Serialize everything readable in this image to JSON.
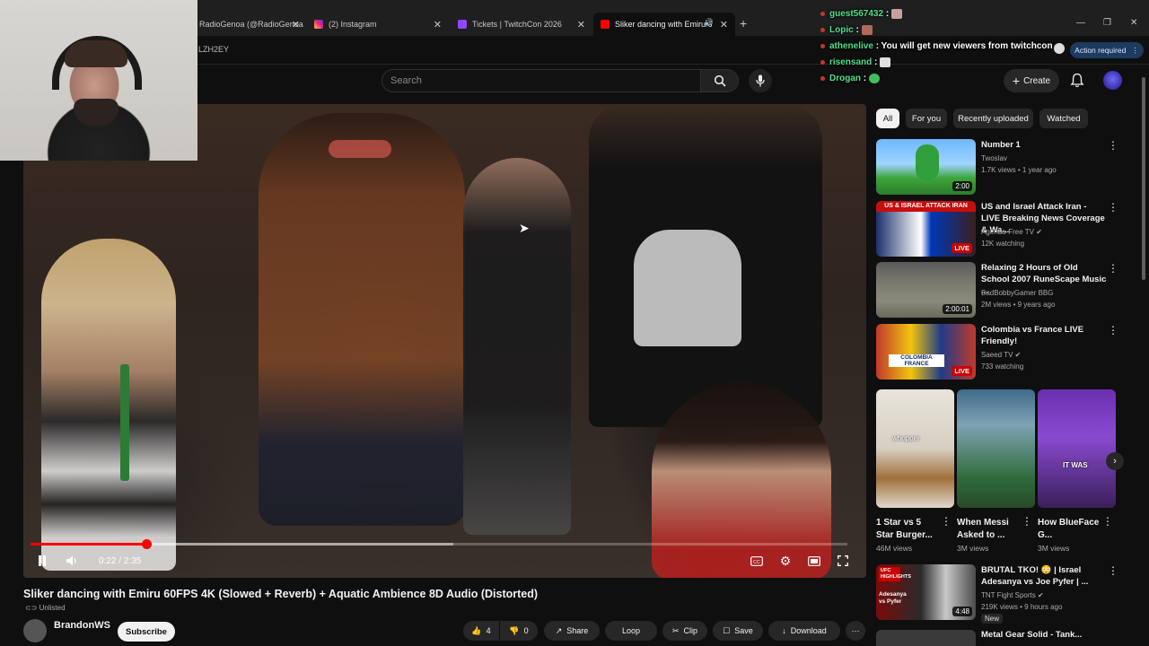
{
  "browser": {
    "tabs": [
      {
        "label": "RadioGenoa (@RadioGenoa"
      },
      {
        "label": "(2) Instagram"
      },
      {
        "label": "Tickets | TwitchCon 2026"
      },
      {
        "label": "Sliker dancing with Emiru 6"
      }
    ],
    "address_fragment": "LZH2EY",
    "action_required": "Action required"
  },
  "header": {
    "search_placeholder": "Search",
    "create_label": "Create"
  },
  "player": {
    "time_display": "0:22 / 2:35",
    "progress_fraction": 0.142,
    "buffer_fraction": 0.518
  },
  "video": {
    "title": "Sliker dancing with Emiru 60FPS 4K (Slowed + Reverb) + Aquatic Ambience 8D Audio (Distorted)",
    "visibility": "Unlisted",
    "channel": "BrandonWS",
    "subscribe_label": "Subscribe",
    "likes": "4",
    "dislikes": "0",
    "share_label": "Share",
    "loop_label": "Loop",
    "clip_label": "Clip",
    "save_label": "Save",
    "download_label": "Download"
  },
  "filters": [
    "All",
    "For you",
    "Recently uploaded",
    "Watched"
  ],
  "recommendations": [
    {
      "title": "Number 1",
      "channel": "Twoslav",
      "meta": "1.7K views • 1 year ago",
      "badge": "2:00"
    },
    {
      "title": "US and Israel Attack Iran - LIVE Breaking News Coverage & Wa...",
      "channel": "Agenda-Free TV",
      "meta": "12K watching",
      "badge": "LIVE",
      "thumb_text": "US & ISRAEL ATTACK IRAN"
    },
    {
      "title": "Relaxing 2 Hours of Old School 2007 RuneScape Music ...",
      "channel": "BadBobbyGamer BBG",
      "meta": "2M views • 9 years ago",
      "badge": "2:00:01"
    },
    {
      "title": "Colombia vs France LIVE Friendly!",
      "channel": "Saeed TV",
      "meta": "733 watching",
      "badge": "LIVE",
      "thumb_text": "COLOMBIA FRANCE"
    }
  ],
  "shorts": [
    {
      "title": "1 Star vs 5 Star Burger...",
      "views": "46M views",
      "thumb_text": "whopper"
    },
    {
      "title": "When Messi Asked to ...",
      "views": "3M views"
    },
    {
      "title": "How BlueFace G...",
      "views": "3M views",
      "thumb_text": "IT WAS"
    }
  ],
  "recommendation_bottom": {
    "title": "BRUTAL TKO! 😳 | Israel Adesanya vs Joe Pyfer | ...",
    "channel": "TNT Fight Sports",
    "meta": "219K views • 9 hours ago",
    "badge": "4:48",
    "new_label": "New",
    "thumb_text": "Adesanya vs Pyfer",
    "tag": "UFC HIGHLIGHTS"
  },
  "recommendation_cut": {
    "title": "Metal Gear Solid - Tank..."
  },
  "chat": [
    {
      "user": "guest567432",
      "message": ""
    },
    {
      "user": "Lopic",
      "message": ""
    },
    {
      "user": "athenelive",
      "message": "You will get new viewers from twitchcon"
    },
    {
      "user": "risensand",
      "message": ""
    },
    {
      "user": "Drogan",
      "message": ""
    }
  ],
  "colors": {
    "accent_red": "#ff0000",
    "chat_username": "#4fe08a",
    "background": "#0f0f0f"
  }
}
